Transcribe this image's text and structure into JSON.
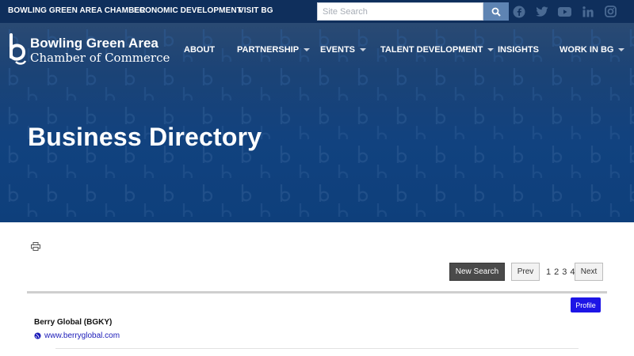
{
  "topbar": {
    "links": [
      "BOWLING GREEN AREA CHAMBER",
      "ECONOMIC DEVELOPMENT",
      "VISIT BG"
    ],
    "search_placeholder": "Site Search",
    "social_icons": [
      "facebook-icon",
      "twitter-icon",
      "youtube-icon",
      "linkedin-icon",
      "instagram-icon"
    ]
  },
  "logo": {
    "line1": "Bowling Green Area",
    "line2": "Chamber of Commerce"
  },
  "nav": {
    "items": [
      {
        "label": "ABOUT",
        "dropdown": false
      },
      {
        "label": "PARTNERSHIP",
        "dropdown": true
      },
      {
        "label": "EVENTS",
        "dropdown": true
      },
      {
        "label": "TALENT DEVELOPMENT",
        "dropdown": true
      },
      {
        "label": "INSIGHTS",
        "dropdown": false
      },
      {
        "label": "WORK IN BG",
        "dropdown": true
      }
    ]
  },
  "hero": {
    "title": "Business Directory"
  },
  "controls": {
    "new_search": "New Search",
    "prev": "Prev",
    "pages": [
      "1",
      "2",
      "3",
      "4"
    ],
    "next": "Next"
  },
  "listing": {
    "profile": "Profile",
    "company": "Berry Global (BGKY)",
    "website": "www.berryglobal.com"
  },
  "colors": {
    "topbar": "#0f2f5c",
    "hero": "#11427f",
    "profile_button": "#1d15e6",
    "link": "#1a1ab8"
  }
}
